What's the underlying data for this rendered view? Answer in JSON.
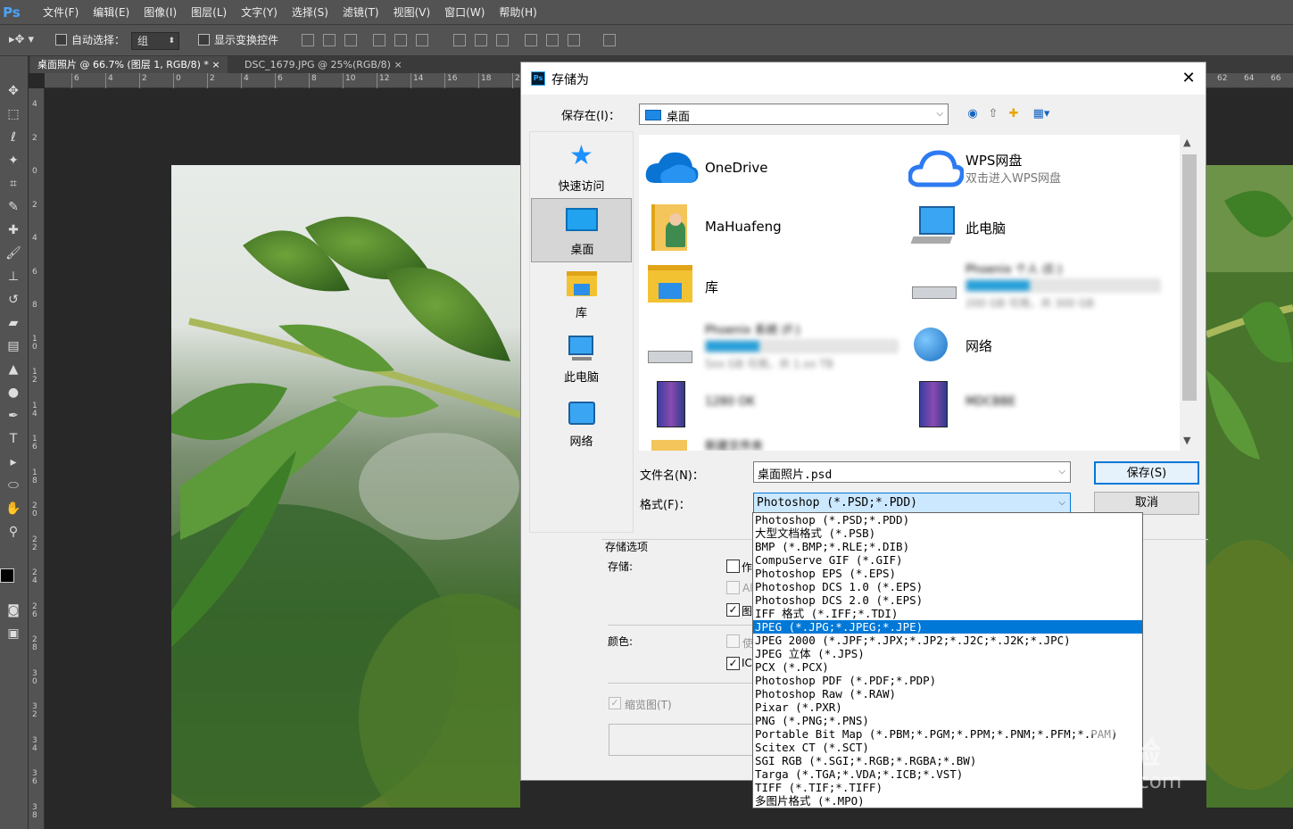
{
  "app": {
    "logo": "Ps"
  },
  "menubar": {
    "items": [
      "文件(F)",
      "编辑(E)",
      "图像(I)",
      "图层(L)",
      "文字(Y)",
      "选择(S)",
      "滤镜(T)",
      "视图(V)",
      "窗口(W)",
      "帮助(H)"
    ]
  },
  "options_bar": {
    "auto_select_label": "自动选择：",
    "auto_select_value": "组",
    "show_transform_label": "显示变换控件"
  },
  "doc_tabs": [
    {
      "label": "桌面照片 @ 66.7% (图层 1, RGB/8) *",
      "active": true
    },
    {
      "label": "DSC_1679.JPG @ 25%(RGB/8)",
      "active": false
    }
  ],
  "ruler": {
    "h_ticks": [
      "6",
      "4",
      "2",
      "0",
      "2",
      "4",
      "6",
      "8",
      "10",
      "12",
      "14",
      "16",
      "18",
      "20"
    ],
    "h_ticks_right": [
      "62",
      "64",
      "66"
    ],
    "v_ticks": [
      "4",
      "2",
      "0",
      "2",
      "4",
      "6",
      "8",
      "1\n0",
      "1\n2",
      "1\n4",
      "1\n6",
      "1\n8",
      "2\n0",
      "2\n2",
      "2\n4",
      "2\n6",
      "2\n8",
      "3\n0",
      "3\n2",
      "3\n4",
      "3\n6",
      "3\n8"
    ]
  },
  "dialog": {
    "title": "存储为",
    "save_in_label": "保存在(I)：",
    "save_in_value": "桌面",
    "places": [
      {
        "label": "快速访问",
        "icon": "star-icon"
      },
      {
        "label": "桌面",
        "icon": "desktop-icon",
        "selected": true
      },
      {
        "label": "库",
        "icon": "library-icon"
      },
      {
        "label": "此电脑",
        "icon": "computer-icon"
      },
      {
        "label": "网络",
        "icon": "network-icon"
      }
    ],
    "files": [
      {
        "name": "OneDrive",
        "icon": "onedrive-icon"
      },
      {
        "name": "WPS网盘",
        "sub": "双击进入WPS网盘",
        "icon": "wps-cloud-icon"
      },
      {
        "name": "MaHuafeng",
        "icon": "user-folder-icon"
      },
      {
        "name": "此电脑",
        "icon": "computer-icon"
      },
      {
        "name": "库",
        "icon": "library-icon"
      },
      {
        "name": "Phoenix 个人 (E:)",
        "sub": "200 GB 可用，共 300 GB",
        "icon": "drive-icon",
        "blurred": true,
        "used_fraction": 0.33
      },
      {
        "name": "Phoenix 系统 (F:)",
        "sub": "5xx GB 可用，共 1.xx TB",
        "icon": "drive-icon",
        "blurred": true,
        "used_fraction": 0.28
      },
      {
        "name": "网络",
        "icon": "network-globe-icon"
      },
      {
        "name": "1280 OK",
        "icon": "rar-icon",
        "blurred": true
      },
      {
        "name": "MDCBBE",
        "icon": "rar-icon",
        "blurred": true
      },
      {
        "name": "新建文件夹",
        "icon": "folder-icon",
        "blurred": true
      }
    ],
    "filename_label": "文件名(N)：",
    "filename_value": "桌面照片.psd",
    "format_label": "格式(F)：",
    "format_value": "Photoshop (*.PSD;*.PDD)",
    "save_button": "保存(S)",
    "cancel_button": "取消",
    "save_options_title": "存储选项",
    "store_label": "存储:",
    "color_label": "颜色:",
    "thumbnail_label": "缩览图(T)",
    "partial_labels": [
      "作",
      "Al",
      "图",
      "使",
      "IC"
    ]
  },
  "format_options": [
    "Photoshop (*.PSD;*.PDD)",
    "大型文档格式 (*.PSB)",
    "BMP (*.BMP;*.RLE;*.DIB)",
    "CompuServe GIF (*.GIF)",
    "Photoshop EPS (*.EPS)",
    "Photoshop DCS 1.0 (*.EPS)",
    "Photoshop DCS 2.0 (*.EPS)",
    "IFF 格式 (*.IFF;*.TDI)",
    "JPEG (*.JPG;*.JPEG;*.JPE)",
    "JPEG 2000 (*.JPF;*.JPX;*.JP2;*.J2C;*.J2K;*.JPC)",
    "JPEG 立体 (*.JPS)",
    "PCX (*.PCX)",
    "Photoshop PDF (*.PDF;*.PDP)",
    "Photoshop Raw (*.RAW)",
    "Pixar (*.PXR)",
    "PNG (*.PNG;*.PNS)",
    "Portable Bit Map (*.PBM;*.PGM;*.PPM;*.PNM;*.PFM;*.PAM)",
    "Scitex CT (*.SCT)",
    "SGI RGB (*.SGI;*.RGB;*.RGBA;*.BW)",
    "Targa (*.TGA;*.VDA;*.ICB;*.VST)",
    "TIFF (*.TIF;*.TIFF)",
    "多图片格式 (*.MPO)"
  ],
  "format_selected_index": 8,
  "watermark": {
    "brand": "Baidu 经验",
    "url": "jingyan.baidu.com"
  },
  "colors": {
    "ps_ui": "#535353",
    "accent": "#0078d7",
    "ps_blue": "#31a8ff"
  }
}
